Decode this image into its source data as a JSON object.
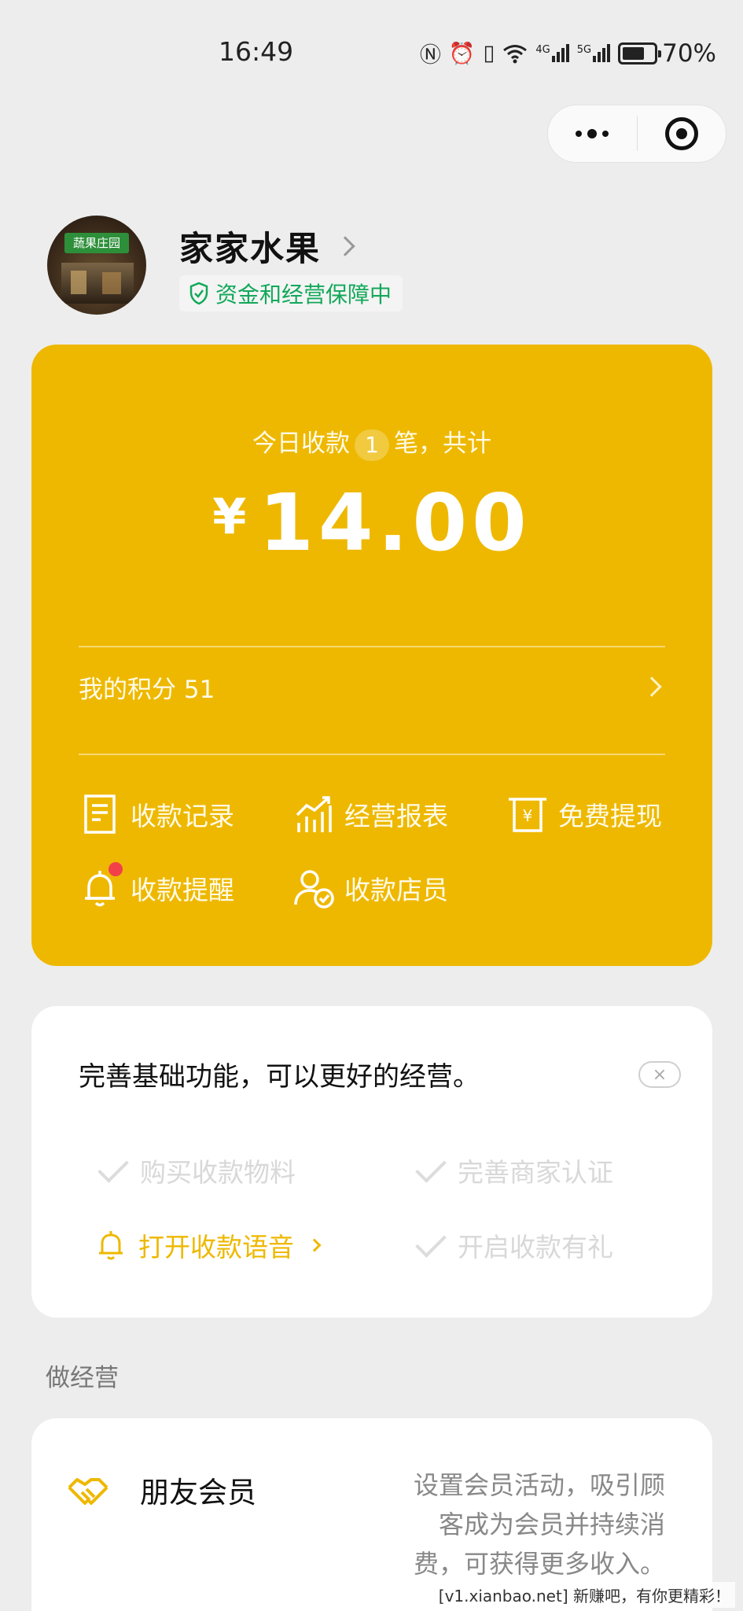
{
  "status_bar": {
    "time": "16:49",
    "icons": [
      "nfc-icon",
      "alarm-icon",
      "vibrate-icon",
      "wifi-icon",
      "signal-4g-icon",
      "signal-5g-icon",
      "battery-icon"
    ],
    "net1": "4G",
    "net2": "5G",
    "battery": "70%",
    "battery_level": 0.7
  },
  "capsule": {
    "more_icon": "more-dots-icon",
    "close_icon": "target-icon"
  },
  "header": {
    "avatar_sign": "蔬果庄园",
    "shop_name": "家家水果",
    "guarantee": "资金和经营保障中"
  },
  "summary": {
    "today_prefix": "今日收款",
    "today_count": "1",
    "today_suffix": "笔，共计",
    "currency": "¥",
    "amount": "14.00",
    "points_label": "我的积分 51"
  },
  "actions": [
    {
      "label": "收款记录",
      "icon": "receipt-icon"
    },
    {
      "label": "经营报表",
      "icon": "chart-trend-icon"
    },
    {
      "label": "免费提现",
      "icon": "withdraw-icon"
    },
    {
      "label": "收款提醒",
      "icon": "bell-icon",
      "badge": true
    },
    {
      "label": "收款店员",
      "icon": "staff-icon"
    }
  ],
  "func_card": {
    "title": "完善基础功能，可以更好的经营。",
    "close": "×",
    "items": [
      {
        "label": "购买收款物料",
        "state": "done"
      },
      {
        "label": "完善商家认证",
        "state": "done"
      },
      {
        "label": "打开收款语音",
        "state": "active"
      },
      {
        "label": "开启收款有礼",
        "state": "done"
      }
    ]
  },
  "section": {
    "title": "做经营",
    "member_title": "朋友会员",
    "member_desc": "设置会员活动，吸引顾客成为会员并持续消费，可获得更多收入。"
  },
  "watermark": "[v1.xianbao.net] 新赚吧，有你更精彩！",
  "colors": {
    "brand_yellow": "#eeb800",
    "guarantee_green": "#13a85a",
    "badge_red": "#f2404a"
  }
}
